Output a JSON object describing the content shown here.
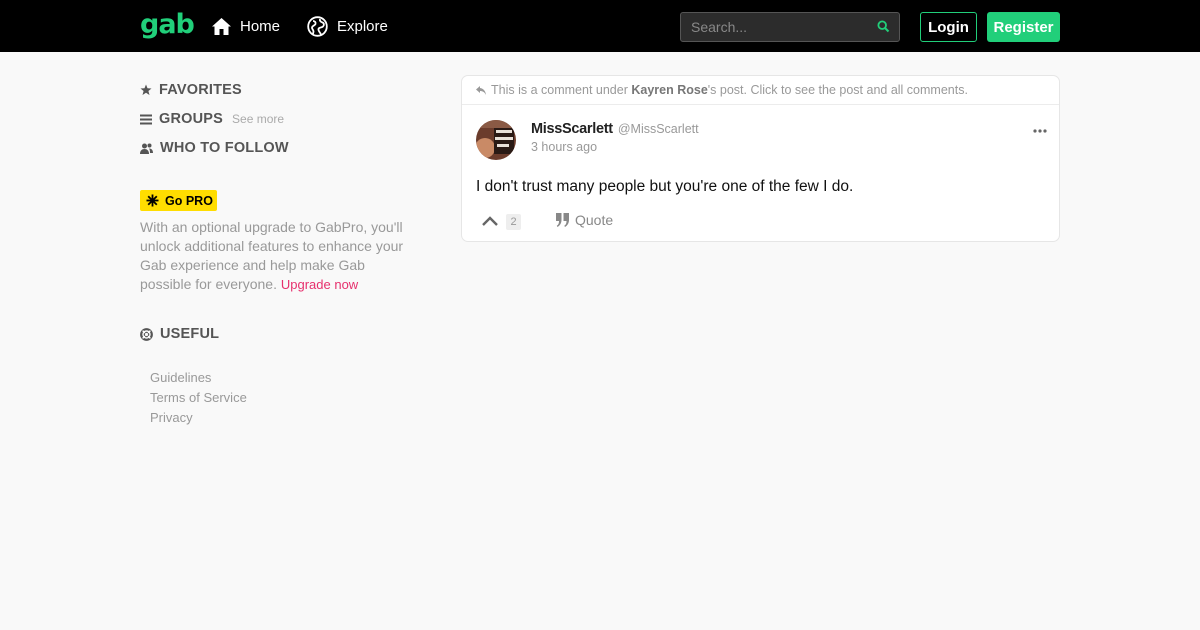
{
  "header": {
    "logo": "gab",
    "nav": [
      {
        "label": "Home",
        "icon": "home-icon"
      },
      {
        "label": "Explore",
        "icon": "globe-icon"
      }
    ],
    "search_placeholder": "Search...",
    "login_label": "Login",
    "register_label": "Register"
  },
  "sidebar": {
    "favorites": "FAVORITES",
    "groups": "GROUPS",
    "groups_see_more": "See more",
    "who_to_follow": "WHO TO FOLLOW",
    "go_pro": "Go PRO",
    "pro_text": "With an optional upgrade to GabPro, you'll unlock additional features to enhance your Gab experience and help make Gab possible for everyone.",
    "pro_link": "Upgrade now",
    "useful": "USEFUL",
    "links": [
      "Guidelines",
      "Terms of Service",
      "Privacy"
    ]
  },
  "post": {
    "note_prefix": "This is a comment under",
    "note_user": "Kayren Rose",
    "note_suffix": "'s post. Click to see the post and all comments.",
    "author_name": "MissScarlett",
    "author_handle": "@MissScarlett",
    "time": "3 hours ago",
    "body": "I don't trust many people but you're one of the few I do.",
    "upvotes": "2",
    "quote_label": "Quote"
  },
  "colors": {
    "brand": "#21cf7a",
    "pro": "#ffdd00",
    "link": "#e6306d"
  }
}
